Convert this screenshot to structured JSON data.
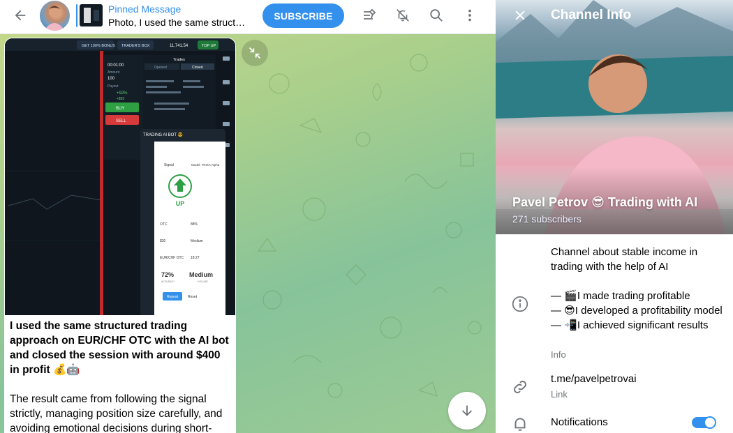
{
  "header": {
    "pinned_title": "Pinned Message",
    "pinned_text": "Photo, I used the same structu…",
    "subscribe_label": "SUBSCRIBE"
  },
  "message": {
    "caption_bold": "I used the same structured trading approach on EUR/CHF OTC with the AI bot and closed the session with around $400 in profit 💰🤖",
    "caption_body": "The result came from following the signal strictly, managing position size carefully, and avoiding emotional decisions during short-"
  },
  "panel": {
    "title": "Channel Info",
    "channel_name": "Pavel Petrov 😎 Trading with AI",
    "subscribers": "271 subscribers",
    "description_intro": "Channel about stable income in trading with the help of AI",
    "description_line1": "— 🎬I made trading profitable",
    "description_line2": "— 😎I developed a profitability model",
    "description_line3": "— 📲I achieved significant results",
    "info_label": "Info",
    "link_text": "t.me/pavelpetrovai",
    "link_label": "Link",
    "notifications_label": "Notifications",
    "notifications_on": true
  },
  "screenshot_in_message": {
    "bonus": "GET 100% BONUS",
    "traders_box": "TRADER'S BOX",
    "balance": "11,741.54",
    "top_up": "TOP UP",
    "trades": "Trades",
    "opened": "Opened",
    "closed": "Closed",
    "time_value": "00:01:00",
    "amount_label": "Amount",
    "amount_value": "100",
    "payout_label": "Payout",
    "payout_pct": "+92%",
    "payout_value": "+$92",
    "buy": "BUY",
    "sell": "SELL",
    "bot_title": "TRADING AI BOT 😎",
    "signal": "Signal",
    "model": "Model: TRIXA Alpha",
    "direction": "UP",
    "market": "OTC",
    "confidence": "88%",
    "time": "$30",
    "strength": "Medium",
    "pair": "EUR/CHF OTC",
    "valid_until": "18:27",
    "accuracy": "72%",
    "volume": "Medium",
    "accuracy_label": "ACCURACY",
    "volume_label": "VOLUME",
    "repeat": "Repeat",
    "reset": "Reset"
  }
}
